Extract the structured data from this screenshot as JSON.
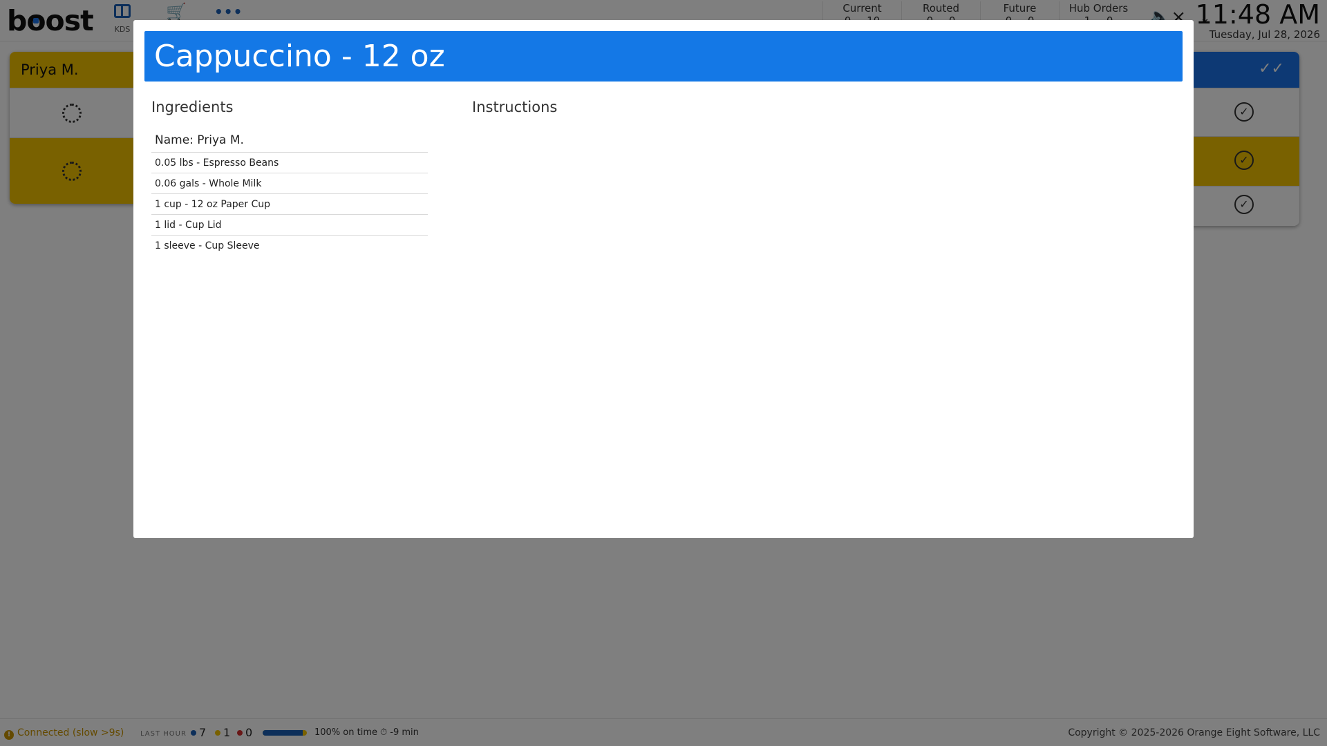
{
  "app": {
    "logo_text_1": "b",
    "logo_text_2": "o",
    "logo_text_3": "ost"
  },
  "nav": {
    "kds_label": "KDS",
    "items": [
      {
        "name": "kds",
        "icon": "kds-layout-icon"
      },
      {
        "name": "orders",
        "icon": "cart-icon"
      },
      {
        "name": "more",
        "icon": "more-icon"
      }
    ]
  },
  "counts": [
    {
      "label": "Current",
      "value": "0  10"
    },
    {
      "label": "Routed",
      "value": "0  0"
    },
    {
      "label": "Future",
      "value": "0  0"
    },
    {
      "label": "Hub Orders",
      "value": "1  0"
    }
  ],
  "clock": {
    "time": "11:48 AM",
    "date": "Tuesday, Jul 28, 2026"
  },
  "background_cards": {
    "left_header": "Priya M."
  },
  "modal": {
    "title": "Cappuccino - 12 oz",
    "ingredients_heading": "Ingredients",
    "instructions_heading": "Instructions",
    "name_line": "Name: Priya M.",
    "ingredients": [
      "0.05 lbs - Espresso Beans",
      "0.06 gals - Whole Milk",
      "1 cup - 12 oz Paper Cup",
      "1 lid - Cup Lid",
      "1 sleeve - Cup Sleeve"
    ]
  },
  "footer": {
    "connection": "Connected (slow >9s)",
    "last_hour_label": "LAST HOUR",
    "stats": [
      {
        "color": "#1a5fb4",
        "value": "7"
      },
      {
        "color": "#f2c200",
        "value": "1"
      },
      {
        "color": "#d32f2f",
        "value": "0"
      }
    ],
    "on_time_fraction": 0.9,
    "on_time_text": "100% on time",
    "timer_text": "-9 min",
    "copyright": "Copyright © 2025-2026 Orange Eight Software, LLC"
  },
  "colors": {
    "brand_blue": "#1478e6",
    "accent_yellow": "#f2c200",
    "warning": "#c99400"
  }
}
